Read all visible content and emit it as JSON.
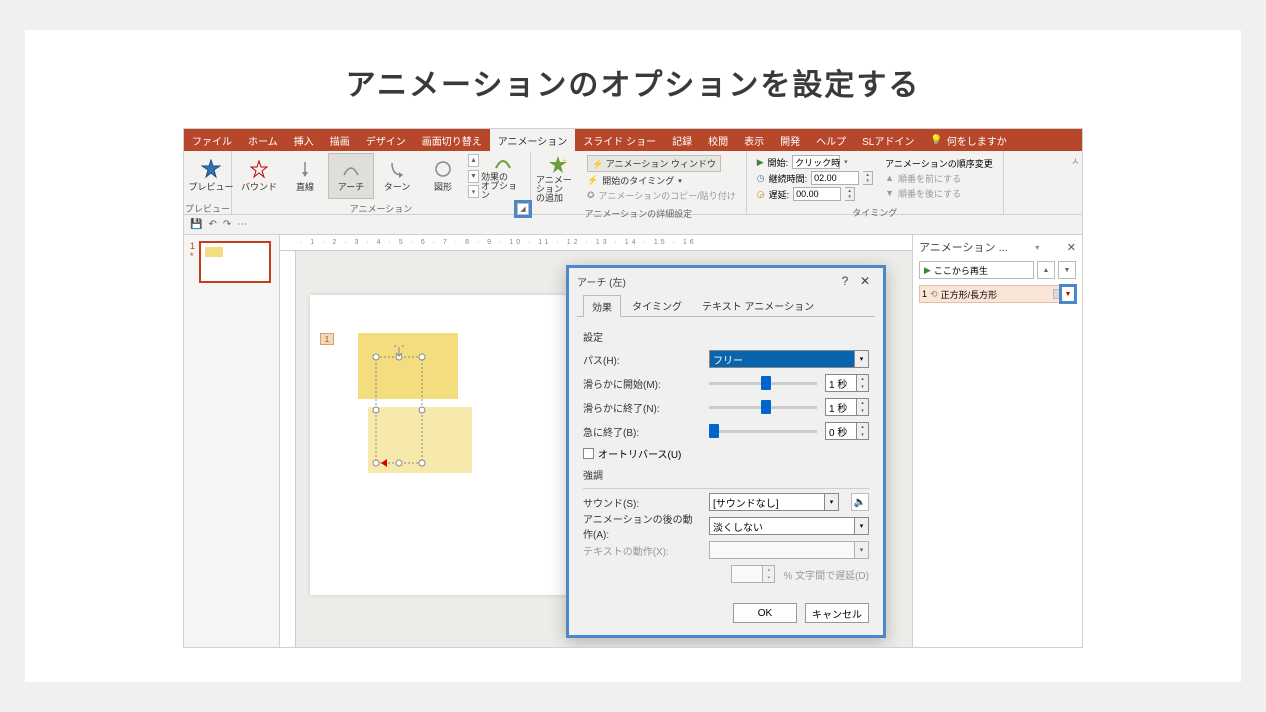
{
  "page_title": "アニメーションのオプションを設定する",
  "tabs": {
    "file": "ファイル",
    "home": "ホーム",
    "insert": "挿入",
    "draw": "描画",
    "design": "デザイン",
    "transition": "画面切り替え",
    "animation": "アニメーション",
    "slideshow": "スライド ショー",
    "record": "記録",
    "review": "校閲",
    "view": "表示",
    "dev": "開発",
    "help": "ヘルプ",
    "sladdin": "SLアドイン",
    "search_placeholder": "何をしますか"
  },
  "ribbon": {
    "preview": "プレビュー",
    "preview_group": "プレビュー",
    "effects": {
      "bound": "バウンド",
      "line": "直線",
      "arch": "アーチ",
      "turn": "ターン",
      "shape": "図形"
    },
    "effect_options": "効果の\nオプション",
    "animation_group": "アニメーション",
    "add_anim": "アニメーション\nの追加",
    "anim_pane_btn": "アニメーション ウィンドウ",
    "trigger": "開始のタイミング",
    "copy_paste": "アニメーションのコピー/貼り付け",
    "advanced_group": "アニメーションの詳細設定",
    "start_label": "開始:",
    "start_value": "クリック時",
    "duration_label": "継続時間:",
    "duration_value": "02.00",
    "delay_label": "遅延:",
    "delay_value": "00.00",
    "timing_group": "タイミング",
    "reorder_label": "アニメーションの順序変更",
    "reorder_up": "順番を前にする",
    "reorder_down": "順番を後にする"
  },
  "thumb": {
    "num": "1",
    "star": "*"
  },
  "anim_pane": {
    "title": "アニメーション ...",
    "play": "ここから再生",
    "item_num": "1",
    "item_label": "正方形/長方形"
  },
  "dialog": {
    "title": "アーチ (左)",
    "tab_effect": "効果",
    "tab_timing": "タイミング",
    "tab_text": "テキスト アニメーション",
    "section_settings": "設定",
    "path_label": "パス(H):",
    "path_value": "フリー",
    "smooth_start": "滑らかに開始(M):",
    "smooth_start_val": "1 秒",
    "smooth_end": "滑らかに終了(N):",
    "smooth_end_val": "1 秒",
    "bounce_end": "急に終了(B):",
    "bounce_end_val": "0 秒",
    "autoreverse": "オートリバース(U)",
    "section_emphasis": "強調",
    "sound_label": "サウンド(S):",
    "sound_value": "[サウンドなし]",
    "after_label": "アニメーションの後の動作(A):",
    "after_value": "淡くしない",
    "text_label": "テキストの動作(X):",
    "percent_label": "% 文字間で遅延(D)",
    "ok": "OK",
    "cancel": "キャンセル"
  },
  "slide_tag": "1"
}
